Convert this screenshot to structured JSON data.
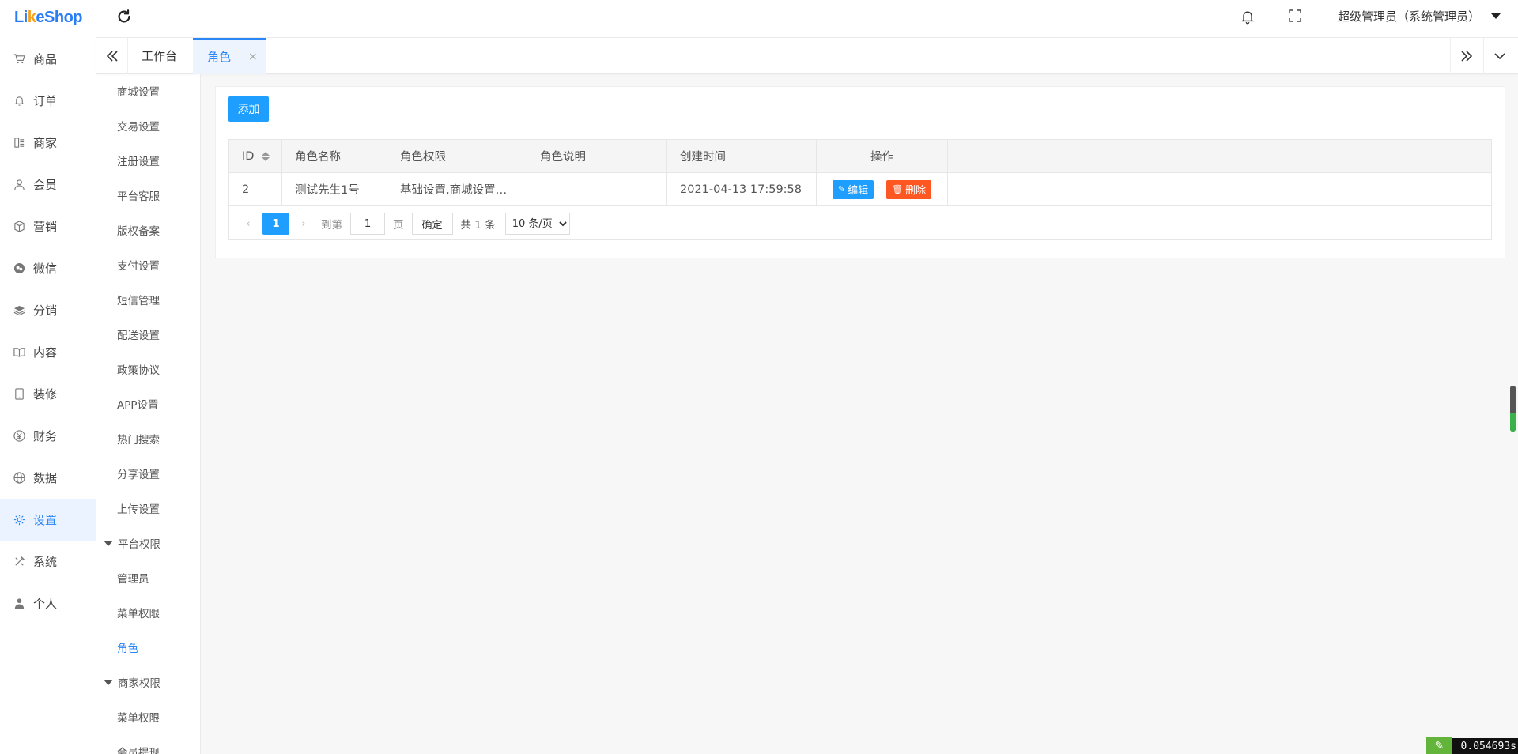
{
  "brand": {
    "prefix": "Li",
    "o": "k",
    "suffix": "eShop"
  },
  "sidebar": {
    "items": [
      {
        "label": "商品",
        "icon": "cart-icon"
      },
      {
        "label": "订单",
        "icon": "bell-icon"
      },
      {
        "label": "商家",
        "icon": "store-icon"
      },
      {
        "label": "会员",
        "icon": "user-icon"
      },
      {
        "label": "营销",
        "icon": "box-icon"
      },
      {
        "label": "微信",
        "icon": "wechat-icon"
      },
      {
        "label": "分销",
        "icon": "layers-icon"
      },
      {
        "label": "内容",
        "icon": "book-icon"
      },
      {
        "label": "装修",
        "icon": "tablet-icon"
      },
      {
        "label": "财务",
        "icon": "yen-icon"
      },
      {
        "label": "数据",
        "icon": "globe-icon"
      },
      {
        "label": "设置",
        "icon": "gear-icon"
      },
      {
        "label": "系统",
        "icon": "tools-icon"
      },
      {
        "label": "个人",
        "icon": "person-icon"
      }
    ],
    "active_index": 11
  },
  "submenu": {
    "items": [
      {
        "label": "商城设置"
      },
      {
        "label": "交易设置"
      },
      {
        "label": "注册设置"
      },
      {
        "label": "平台客服"
      },
      {
        "label": "版权备案"
      },
      {
        "label": "支付设置"
      },
      {
        "label": "短信管理"
      },
      {
        "label": "配送设置"
      },
      {
        "label": "政策协议"
      },
      {
        "label": "APP设置"
      },
      {
        "label": "热门搜索"
      },
      {
        "label": "分享设置"
      },
      {
        "label": "上传设置"
      },
      {
        "label": "平台权限",
        "group": true
      },
      {
        "label": "管理员"
      },
      {
        "label": "菜单权限"
      },
      {
        "label": "角色",
        "active": true
      },
      {
        "label": "商家权限",
        "group": true
      },
      {
        "label": "菜单权限"
      },
      {
        "label": "会员提现"
      }
    ]
  },
  "header": {
    "user": "超级管理员（系统管理员）"
  },
  "tabs": {
    "home": "工作台",
    "current": "角色",
    "close": "×"
  },
  "content": {
    "add_label": "添加",
    "columns": [
      "ID",
      "角色名称",
      "角色权限",
      "角色说明",
      "创建时间",
      "操作"
    ],
    "rows": [
      {
        "id": "2",
        "name": "测试先生1号",
        "perm": "基础设置,商城设置…",
        "desc": "",
        "created": "2021-04-13 17:59:58"
      }
    ],
    "edit_label": "编辑",
    "delete_label": "删除"
  },
  "pager": {
    "prev": "‹",
    "current": "1",
    "next": "›",
    "goto_label": "到第",
    "goto_value": "1",
    "page_unit": "页",
    "ok_label": "确定",
    "total": "共 1 条",
    "page_size": "10 条/页"
  },
  "debug": {
    "timer": "0.054693s"
  }
}
